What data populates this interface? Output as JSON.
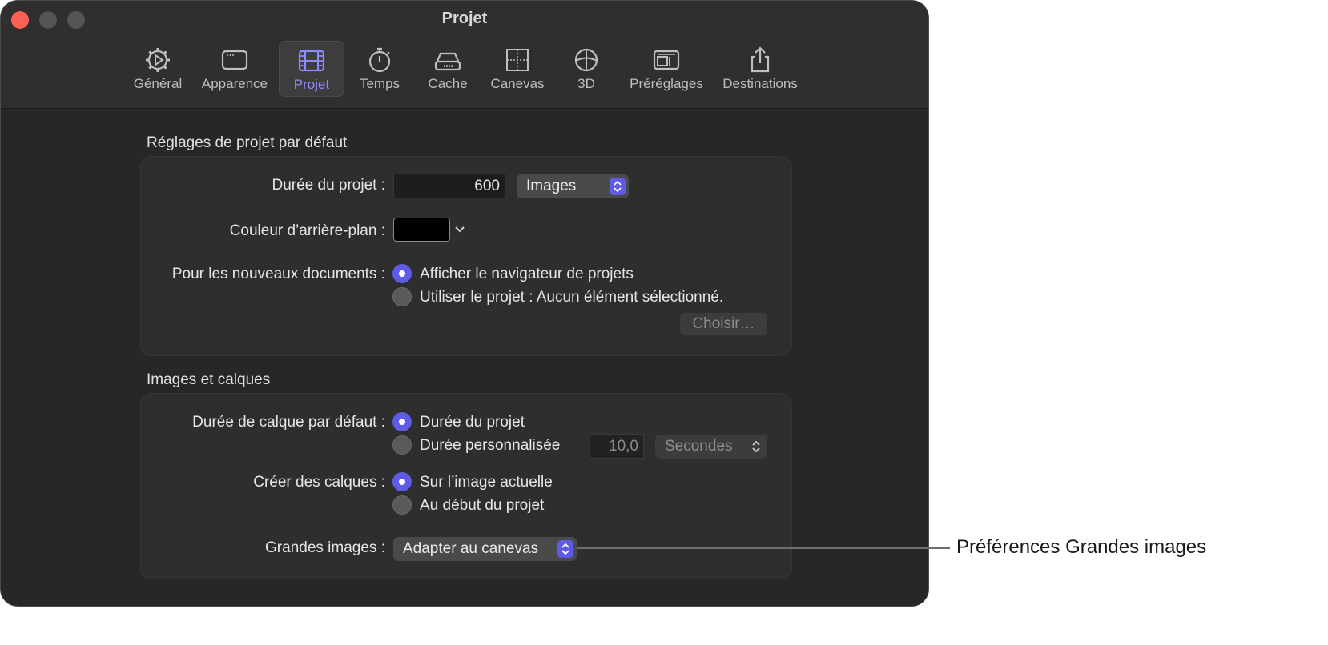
{
  "window": {
    "title": "Projet"
  },
  "toolbar": {
    "tabs": [
      {
        "label": "Général",
        "icon": "gear-icon"
      },
      {
        "label": "Apparence",
        "icon": "window-icon"
      },
      {
        "label": "Projet",
        "icon": "film-icon",
        "selected": true
      },
      {
        "label": "Temps",
        "icon": "stopwatch-icon"
      },
      {
        "label": "Cache",
        "icon": "drive-icon"
      },
      {
        "label": "Canevas",
        "icon": "canvas-icon"
      },
      {
        "label": "3D",
        "icon": "globe-icon"
      },
      {
        "label": "Préréglages",
        "icon": "presets-icon"
      },
      {
        "label": "Destinations",
        "icon": "share-icon"
      }
    ]
  },
  "defaults": {
    "title": "Réglages de projet par défaut",
    "duration_label": "Durée du projet :",
    "duration_value": "600",
    "duration_unit": "Images",
    "bg_label": "Couleur d’arrière-plan :",
    "bg_color": "#000000",
    "new_docs_label": "Pour les nouveaux documents :",
    "option_browser": "Afficher le navigateur de projets",
    "option_use_project": "Utiliser le projet : Aucun élément sélectionné.",
    "choose_button": "Choisir…"
  },
  "layers": {
    "title": "Images et calques",
    "layer_duration_label": "Durée de calque par défaut :",
    "option_project_duration": "Durée du projet",
    "option_custom_duration": "Durée personnalisée",
    "custom_value": "10,0",
    "custom_unit": "Secondes",
    "create_label": "Créer des calques :",
    "option_current_frame": "Sur l’image actuelle",
    "option_project_start": "Au début du projet",
    "large_label": "Grandes images :",
    "large_value": "Adapter au canevas"
  },
  "callout": {
    "text": "Préférences Grandes images"
  },
  "colors": {
    "accent": "#5e5ce6",
    "close": "#fe5f57"
  }
}
